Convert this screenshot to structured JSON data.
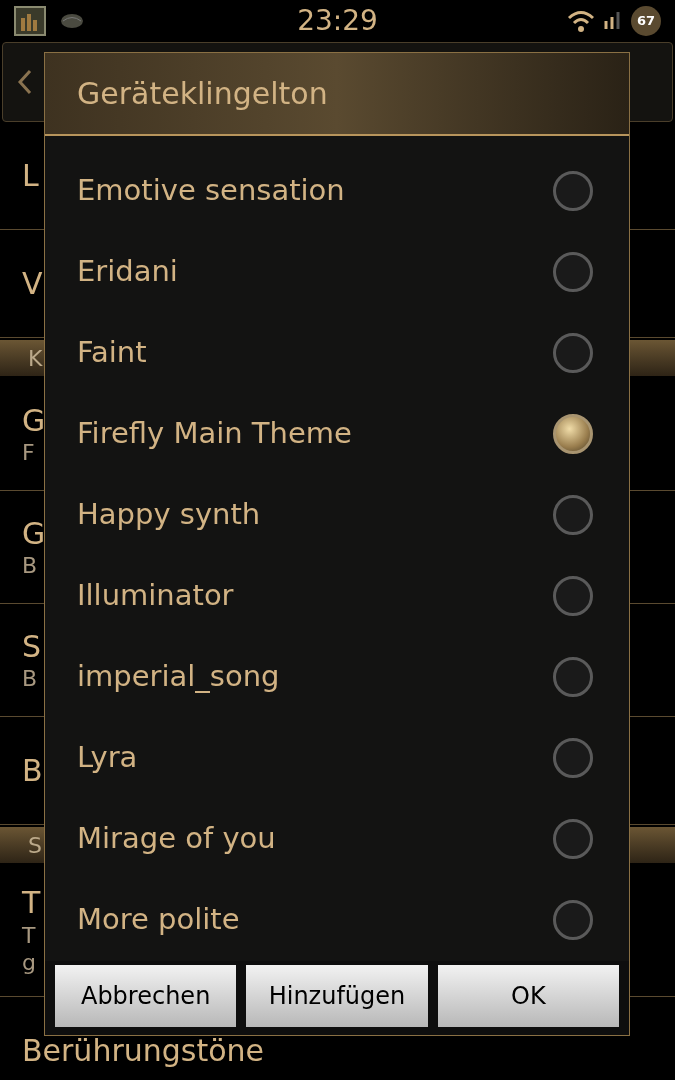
{
  "status_bar": {
    "time": "23:29",
    "battery": "67"
  },
  "background": {
    "rows": [
      {
        "kind": "item",
        "title": "L"
      },
      {
        "kind": "item",
        "title": "V"
      },
      {
        "kind": "header",
        "title": "K"
      },
      {
        "kind": "item",
        "title": "G",
        "subtitle": "F"
      },
      {
        "kind": "item",
        "title": "G",
        "subtitle": "B"
      },
      {
        "kind": "item",
        "title": "S",
        "subtitle": "B"
      },
      {
        "kind": "item",
        "title": "B"
      },
      {
        "kind": "header",
        "title": "S"
      },
      {
        "kind": "item",
        "title": "T",
        "subtitle": "T",
        "subtitle2": "g"
      },
      {
        "kind": "item",
        "title": "Berührungstöne"
      }
    ]
  },
  "dialog": {
    "title": "Geräteklingelton",
    "options": [
      {
        "label": "Emotive sensation",
        "selected": false
      },
      {
        "label": "Eridani",
        "selected": false
      },
      {
        "label": "Faint",
        "selected": false
      },
      {
        "label": "Firefly Main Theme",
        "selected": true
      },
      {
        "label": "Happy synth",
        "selected": false
      },
      {
        "label": "Illuminator",
        "selected": false
      },
      {
        "label": "imperial_song",
        "selected": false
      },
      {
        "label": "Lyra",
        "selected": false
      },
      {
        "label": "Mirage of you",
        "selected": false
      },
      {
        "label": "More polite",
        "selected": false
      }
    ],
    "buttons": [
      "Abbrechen",
      "Hinzufügen",
      "OK"
    ]
  }
}
